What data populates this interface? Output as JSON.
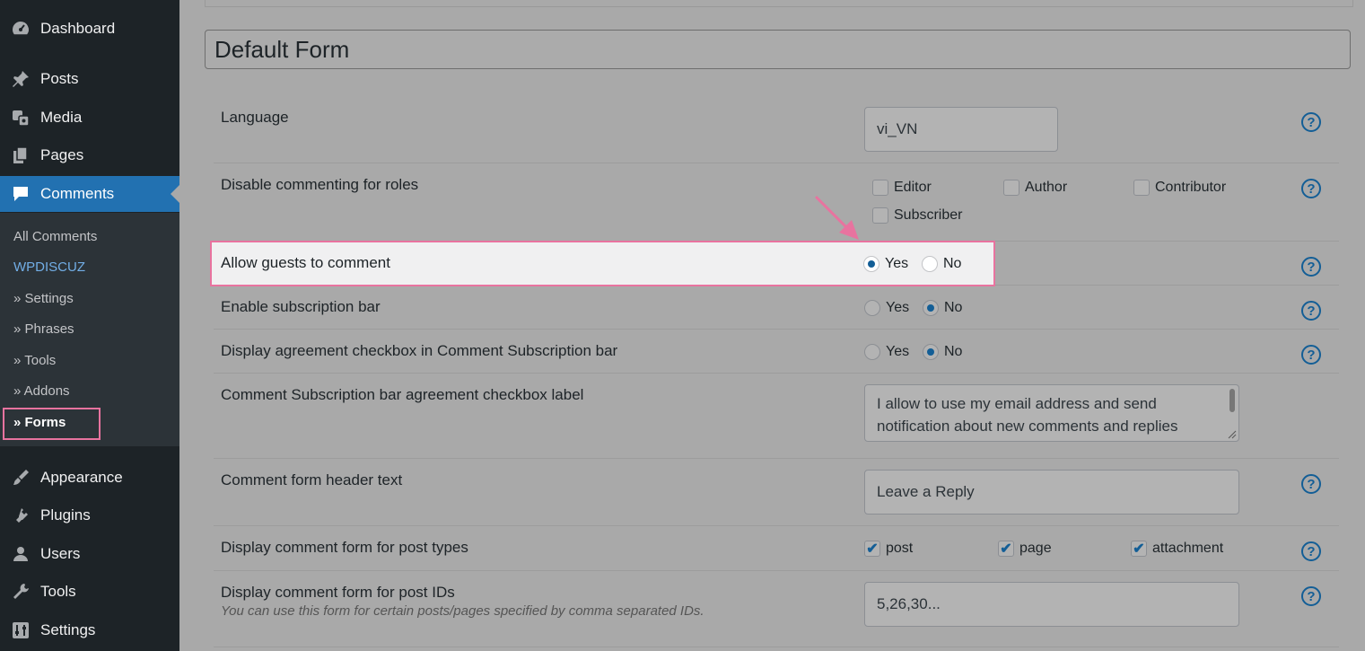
{
  "sidebar": {
    "menu": [
      {
        "label": "Dashboard",
        "icon": "dashboard-icon"
      },
      {
        "label": "Posts",
        "icon": "pin-icon"
      },
      {
        "label": "Media",
        "icon": "media-icon"
      },
      {
        "label": "Pages",
        "icon": "pages-icon"
      },
      {
        "label": "Comments",
        "icon": "comment-icon"
      },
      {
        "label": "Appearance",
        "icon": "brush-icon"
      },
      {
        "label": "Plugins",
        "icon": "plug-icon"
      },
      {
        "label": "Users",
        "icon": "user-icon"
      },
      {
        "label": "Tools",
        "icon": "wrench-icon"
      },
      {
        "label": "Settings",
        "icon": "settings-icon"
      }
    ],
    "submenu": [
      "All Comments",
      "WPDISCUZ",
      "» Settings",
      "» Phrases",
      "» Tools",
      "» Addons",
      "» Forms"
    ]
  },
  "form": {
    "title": "Default Form",
    "language": {
      "label": "Language",
      "value": "vi_VN"
    },
    "disable_roles": {
      "label": "Disable commenting for roles",
      "options": [
        "Editor",
        "Author",
        "Contributor",
        "Subscriber"
      ]
    },
    "allow_guests": {
      "label": "Allow guests to comment",
      "yes": "Yes",
      "no": "No",
      "selected": "Yes"
    },
    "subscription_bar": {
      "label": "Enable subscription bar",
      "yes": "Yes",
      "no": "No",
      "selected": "No"
    },
    "agreement_checkbox": {
      "label": "Display agreement checkbox in Comment Subscription bar",
      "yes": "Yes",
      "no": "No",
      "selected": "No"
    },
    "agreement_label": {
      "label": "Comment Subscription bar agreement checkbox label",
      "value": "I allow to use my email address and send notification about new comments and replies"
    },
    "header_text": {
      "label": "Comment form header text",
      "value": "Leave a Reply"
    },
    "post_types": {
      "label": "Display comment form for post types",
      "options": [
        "post",
        "page",
        "attachment"
      ]
    },
    "post_ids": {
      "label": "Display comment form for post IDs",
      "hint": "You can use this form for certain posts/pages specified by comma separated IDs.",
      "placeholder": "5,26,30..."
    }
  },
  "help_glyph": "?",
  "check_glyph": "✔",
  "colors": {
    "sidebar": "#1d2327",
    "active": "#2271b1",
    "highlight": "#e8739f",
    "accent": "#135e96"
  }
}
